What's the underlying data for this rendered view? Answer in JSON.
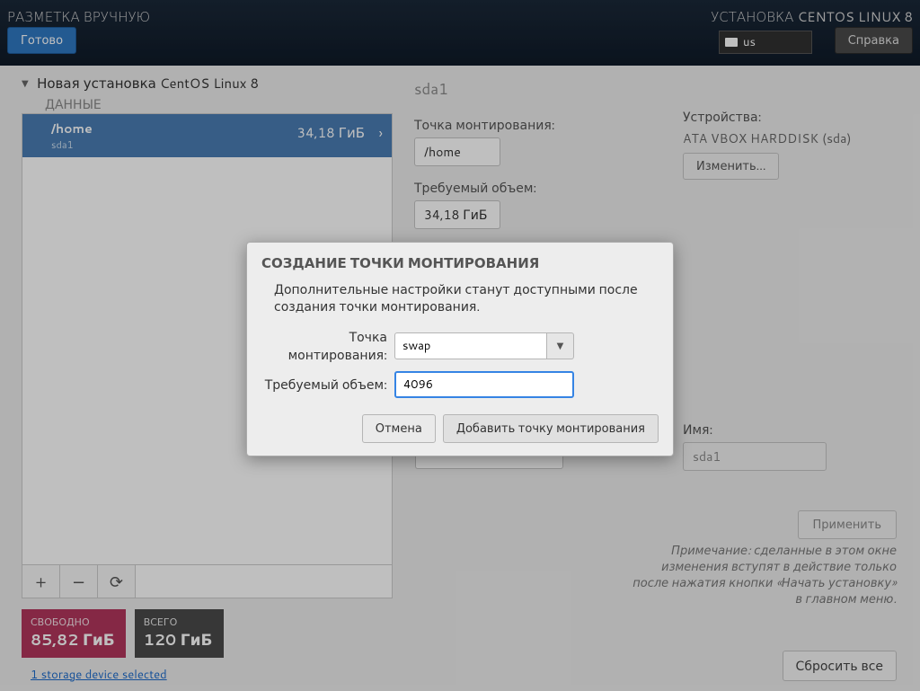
{
  "topbar": {
    "title": "РАЗМЕТКА ВРУЧНУЮ",
    "subtitle": "УСТАНОВКА CENTOS LINUX 8",
    "done": "Готово",
    "help": "Справка",
    "kb_layout": "us"
  },
  "sidebar": {
    "install_name": "Новая установка CentOS Linux 8",
    "section": "ДАННЫЕ",
    "partitions": [
      {
        "mount": "/home",
        "device": "sda1",
        "size": "34,18 ГиБ"
      }
    ],
    "toolbar": {
      "add": "+",
      "remove": "−",
      "reload": "⟳"
    },
    "summary": {
      "free_label": "СВОБОДНО",
      "free_value": "85,82 ГиБ",
      "total_label": "ВСЕГО",
      "total_value": "120 ГиБ"
    },
    "storage_link": "1 storage device selected"
  },
  "details": {
    "device_title": "sda1",
    "mount_label": "Точка монтирования:",
    "mount_value": "/home",
    "capacity_label": "Требуемый объем:",
    "capacity_value": "34,18 ГиБ",
    "devices_label": "Устройства:",
    "device_name": "ATA VBOX HARDDISK (sda)",
    "modify": "Изменить...",
    "name_label": "Имя:",
    "name_value": "sda1",
    "apply": "Применить",
    "note": "Примечание:  сделанные в этом окне изменения вступят в действие только после нажатия кнопки «Начать установку» в главном меню.",
    "reset": "Сбросить все"
  },
  "modal": {
    "title": "СОЗДАНИЕ ТОЧКИ МОНТИРОВАНИЯ",
    "description": "Дополнительные настройки станут доступными после создания точки монтирования.",
    "mount_label": "Точка монтирования:",
    "mount_value": "swap",
    "capacity_label": "Требуемый объем:",
    "capacity_value": "4096",
    "cancel": "Отмена",
    "add": "Добавить точку монтирования"
  }
}
